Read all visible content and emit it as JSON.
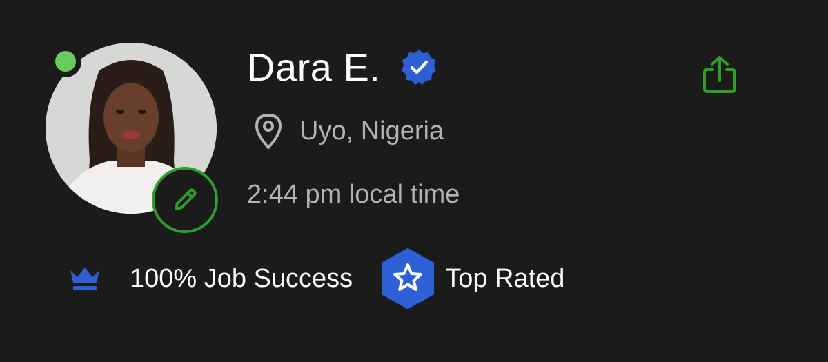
{
  "profile": {
    "name": "Dara E.",
    "location": "Uyo, Nigeria",
    "local_time": "2:44 pm local time",
    "online": true,
    "verified": true
  },
  "stats": {
    "job_success": "100% Job Success",
    "badge": "Top Rated"
  },
  "icons": {
    "online": "online-status-dot",
    "edit": "pencil-icon",
    "verified": "verified-badge-icon",
    "share": "share-icon",
    "location": "map-pin-icon",
    "job_success": "crown-icon",
    "badge": "star-badge-icon"
  },
  "colors": {
    "background": "#1b1b1c",
    "accent_green": "#2f9e2a",
    "online_green": "#68c95c",
    "badge_blue": "#2f5fd4",
    "text_primary": "#ffffff",
    "text_secondary": "#b3b3b3"
  }
}
